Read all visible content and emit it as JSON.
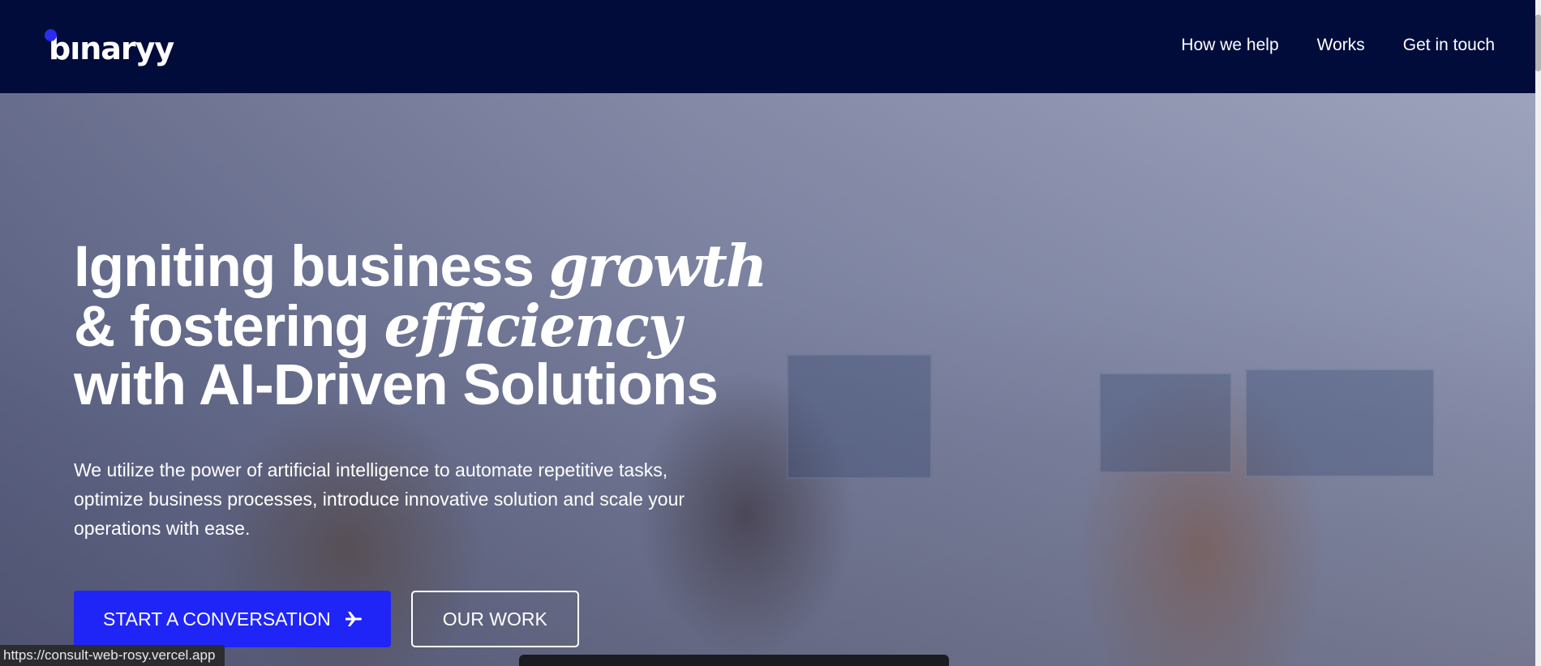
{
  "header": {
    "logo_text": "bınaryy",
    "nav": [
      "How we help",
      "Works",
      "Get in touch"
    ]
  },
  "hero": {
    "headline": {
      "line1_plain": "Igniting business ",
      "line1_italic": "growth",
      "line2_plain": "& fostering ",
      "line2_italic": "efficiency",
      "line3": "with AI-Driven Solutions"
    },
    "subtext": "We utilize the power of artificial intelligence to automate repetitive tasks, optimize business processes, introduce innovative solution and scale your operations with ease.",
    "primary_button": "START A CONVERSATION",
    "primary_button_icon": "plane-icon",
    "secondary_button": "OUR WORK"
  },
  "status_bar": {
    "url": "https://consult-web-rosy.vercel.app"
  },
  "colors": {
    "nav_background": "#010c3b",
    "accent": "#2025f7",
    "logo_dot": "#2a2cf0"
  }
}
